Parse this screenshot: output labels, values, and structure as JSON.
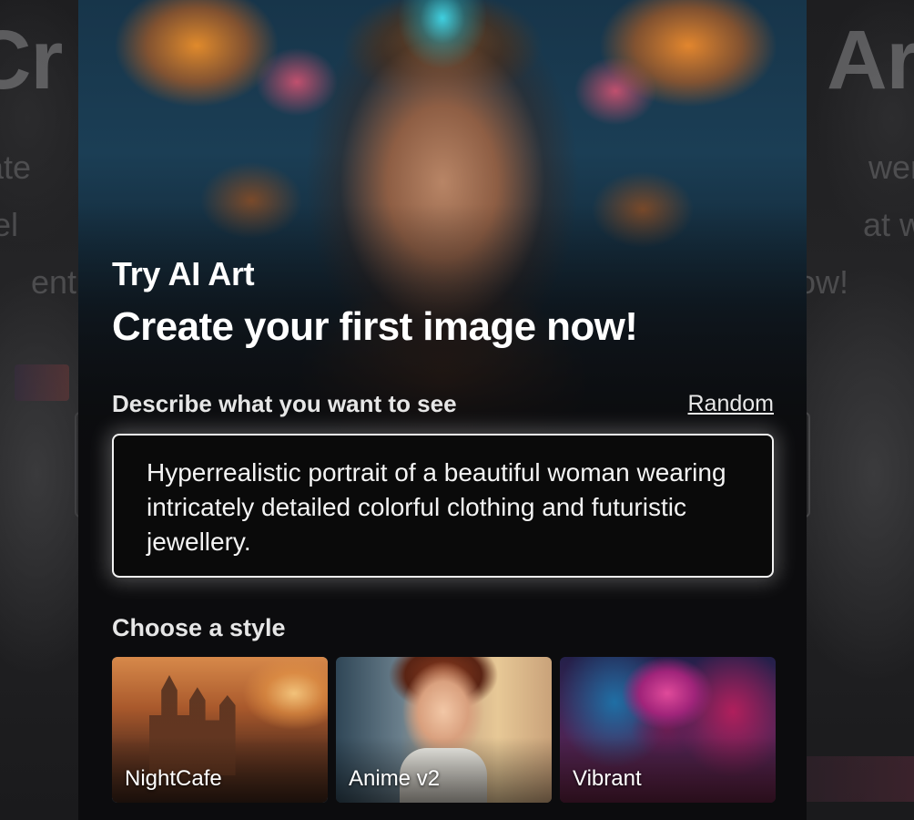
{
  "backdrop": {
    "heading_left": "Cr",
    "heading_right": "Art",
    "lines": [
      {
        "left": "reate",
        "right": "wer of"
      },
      {
        "left": "Intel",
        "right": "at with"
      },
      {
        "left": "ent",
        "right": "ow!"
      }
    ]
  },
  "modal": {
    "eyebrow": "Try AI Art",
    "headline": "Create your first image now!",
    "prompt_label": "Describe what you want to see",
    "random_label": "Random",
    "prompt_text": "Hyperrealistic portrait of a beautiful woman wearing intricately detailed colorful clothing and futuristic jewellery.",
    "style_label": "Choose a style",
    "styles": [
      {
        "label": "NightCafe",
        "selected": true
      },
      {
        "label": "Anime v2",
        "selected": false
      },
      {
        "label": "Vibrant",
        "selected": false
      }
    ]
  },
  "colors": {
    "selected_outline": "#2a86c9",
    "modal_background": "#0c0c0e",
    "prompt_border": "#f2f2f2"
  },
  "icons": {
    "hero_image": "portrait-illustration"
  }
}
